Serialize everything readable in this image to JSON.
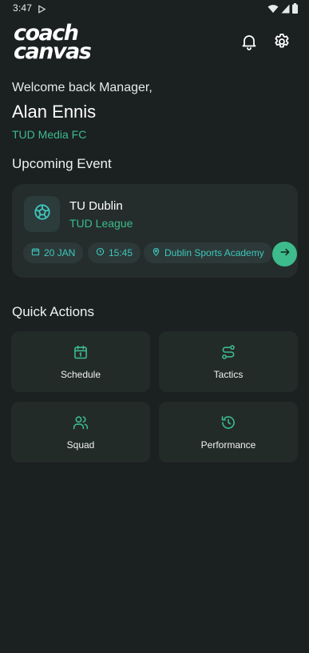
{
  "status_bar": {
    "time": "3:47"
  },
  "header": {
    "logo_line1": "coach",
    "logo_line2": "canvas"
  },
  "welcome": {
    "greeting": "Welcome back Manager,",
    "name": "Alan Ennis",
    "team": "TUD Media FC"
  },
  "upcoming": {
    "section_title": "Upcoming Event",
    "event": {
      "title": "TU Dublin",
      "league": "TUD League",
      "date": "20 JAN",
      "time": "15:45",
      "location": "Dublin Sports Academy"
    }
  },
  "quick_actions": {
    "section_title": "Quick Actions",
    "items": [
      {
        "label": "Schedule",
        "icon": "calendar-icon"
      },
      {
        "label": "Tactics",
        "icon": "route-icon"
      },
      {
        "label": "Squad",
        "icon": "users-icon"
      },
      {
        "label": "Performance",
        "icon": "history-icon"
      }
    ]
  },
  "colors": {
    "background": "#1b2021",
    "card": "#242d2b",
    "accent_green": "#3dbb8d",
    "accent_teal": "#3fc6bd"
  }
}
